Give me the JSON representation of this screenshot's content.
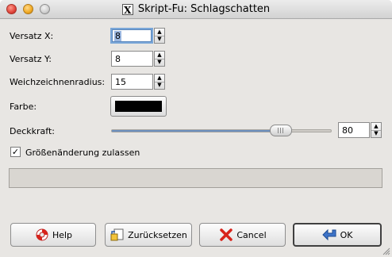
{
  "window": {
    "title": "Skript-Fu: Schlagschatten",
    "title_icon": "X"
  },
  "fields": {
    "offset_x": {
      "label": "Versatz X:",
      "value": "8"
    },
    "offset_y": {
      "label": "Versatz Y:",
      "value": "8"
    },
    "blur_radius": {
      "label": "Weichzeichnenradius:",
      "value": "15"
    },
    "color": {
      "label": "Farbe:",
      "value": "#000000"
    },
    "opacity": {
      "label": "Deckkraft:",
      "value": "80",
      "fraction": 0.8
    },
    "allow_resize": {
      "label": "Größenänderung zulassen",
      "checked": true,
      "mark": "✓"
    }
  },
  "progress": {
    "fraction": 0
  },
  "buttons": {
    "help": {
      "label": "Help",
      "icon": "lifebuoy-icon"
    },
    "reset": {
      "label": "Zurücksetzen",
      "icon": "reset-icon"
    },
    "cancel": {
      "label": "Cancel",
      "icon": "cancel-x-icon"
    },
    "ok": {
      "label": "OK",
      "icon": "ok-arrow-icon"
    }
  },
  "colors": {
    "accent": "#7aa7d8",
    "cancel_red": "#d8231a",
    "ok_blue": "#3e74c9"
  }
}
